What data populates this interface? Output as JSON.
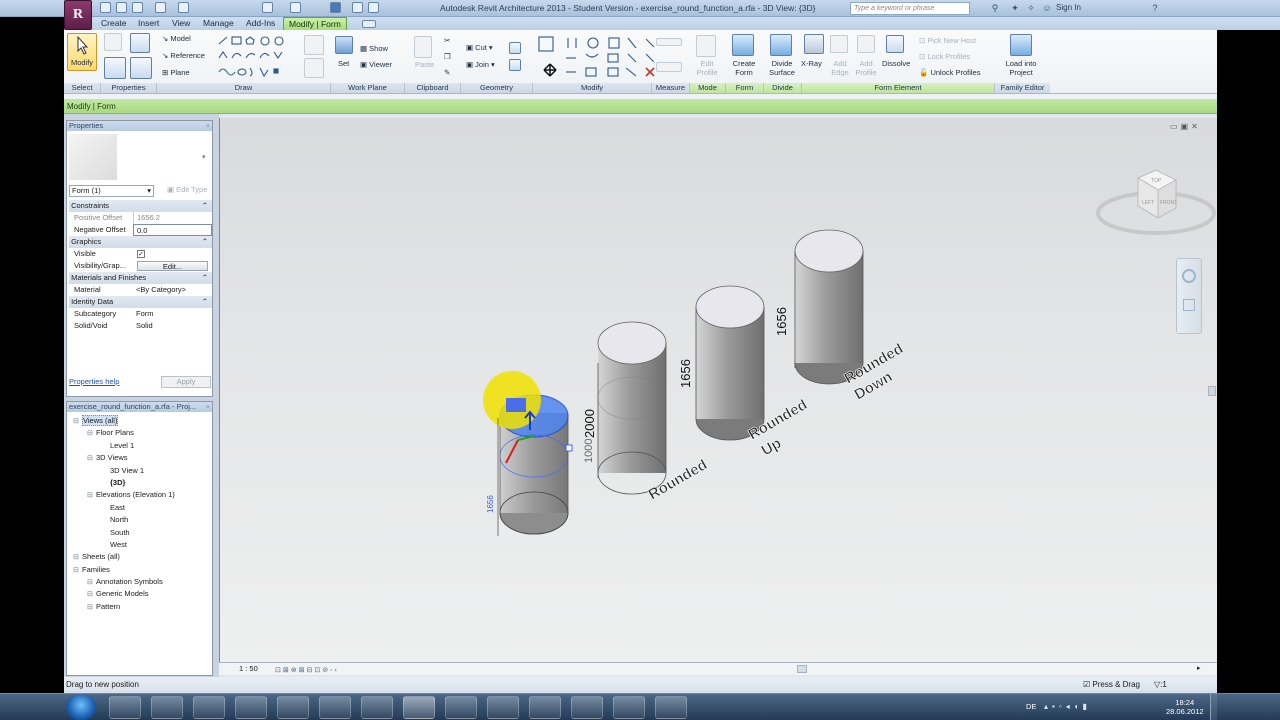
{
  "title": "Autodesk Revit Architecture 2013 - Student Version -     exercise_round_function_a.rfa - 3D View: {3D}",
  "search_placeholder": "Type a keyword or phrase",
  "sign_in": "Sign In",
  "tabs": [
    "Create",
    "Insert",
    "View",
    "Manage",
    "Add-Ins",
    "Modify | Form"
  ],
  "ribbon": {
    "modify": "Modify",
    "model": "Model",
    "reference": "Reference",
    "plane": "Plane",
    "set": "Set",
    "show": "Show",
    "viewer": "Viewer",
    "paste": "Paste",
    "cut": "Cut",
    "join": "Join",
    "edit_profile": "Edit Profile",
    "create_form": "Create Form",
    "divide_surface": "Divide Surface",
    "xray": "X-Ray",
    "add_edge": "Add Edge",
    "add_profile": "Add Profile",
    "dissolve": "Dissolve",
    "pick_new_host": "Pick New Host",
    "lock_profiles": "Lock Profiles",
    "unlock_profiles": "Unlock Profiles",
    "load_into_project": "Load into Project",
    "panels": [
      "Select",
      "Properties",
      "Draw",
      "Work Plane",
      "Clipboard",
      "Geometry",
      "Modify",
      "Measure",
      "Mode",
      "Form",
      "Divide",
      "Form Element",
      "Family Editor"
    ]
  },
  "options_bar": "Modify | Form",
  "properties": {
    "header": "Properties",
    "type_selector": "Form (1)",
    "edit_type": "Edit Type",
    "groups": {
      "constraints": "Constraints",
      "graphics": "Graphics",
      "materials": "Materials and Finishes",
      "identity": "Identity Data"
    },
    "positive_offset_label": "Positive Offset",
    "positive_offset_value": "1656.2",
    "negative_offset_label": "Negative Offset",
    "negative_offset_value": "0.0",
    "visible_label": "Visible",
    "visible_value": "✓",
    "visibility_label": "Visibility/Grap...",
    "visibility_value": "Edit...",
    "material_label": "Material",
    "material_value": "<By Category>",
    "subcategory_label": "Subcategory",
    "subcategory_value": "Form",
    "solid_label": "Solid/Void",
    "solid_value": "Solid",
    "help": "Properties help",
    "apply": "Apply"
  },
  "browser": {
    "header": "exercise_round_function_a.rfa - Proj...",
    "items": [
      {
        "label": "Views (all)",
        "indent": 0,
        "bold": false
      },
      {
        "label": "Floor Plans",
        "indent": 1,
        "bold": false
      },
      {
        "label": "Level 1",
        "indent": 2,
        "bold": false
      },
      {
        "label": "3D Views",
        "indent": 1,
        "bold": false
      },
      {
        "label": "3D View 1",
        "indent": 2,
        "bold": false
      },
      {
        "label": "{3D}",
        "indent": 2,
        "bold": true
      },
      {
        "label": "Elevations (Elevation 1)",
        "indent": 1,
        "bold": false
      },
      {
        "label": "East",
        "indent": 2,
        "bold": false
      },
      {
        "label": "North",
        "indent": 2,
        "bold": false
      },
      {
        "label": "South",
        "indent": 2,
        "bold": false
      },
      {
        "label": "West",
        "indent": 2,
        "bold": false
      },
      {
        "label": "Sheets (all)",
        "indent": 0,
        "bold": false
      },
      {
        "label": "Families",
        "indent": 0,
        "bold": false
      },
      {
        "label": "Annotation Symbols",
        "indent": 1,
        "bold": false
      },
      {
        "label": "Generic Models",
        "indent": 1,
        "bold": false
      },
      {
        "label": "Pattern",
        "indent": 1,
        "bold": false
      }
    ]
  },
  "viewport": {
    "dim_1656_a": "1656",
    "dim_1656_b": "1656",
    "dim_2000": "2000",
    "dim_1000": "1000",
    "dim_blue": "1656",
    "label_rounded": "Rounded",
    "label_rounded_up": "Rounded\nUp",
    "label_rounded_down": "Rounded\nDown",
    "viewcube_top": "TOP",
    "viewcube_left": "LEFT",
    "viewcube_front": "FRONT"
  },
  "scale": "1 : 50",
  "status_text": "Drag to new position",
  "press_drag": "Press & Drag",
  "filter_count": ":1",
  "lang": "DE",
  "clock_time": "18:24",
  "clock_date": "28.06.2012",
  "colors": {
    "accent_green": "#a9dc7e",
    "selection_blue": "#3366ff",
    "highlight_yellow": "#f0e000"
  }
}
